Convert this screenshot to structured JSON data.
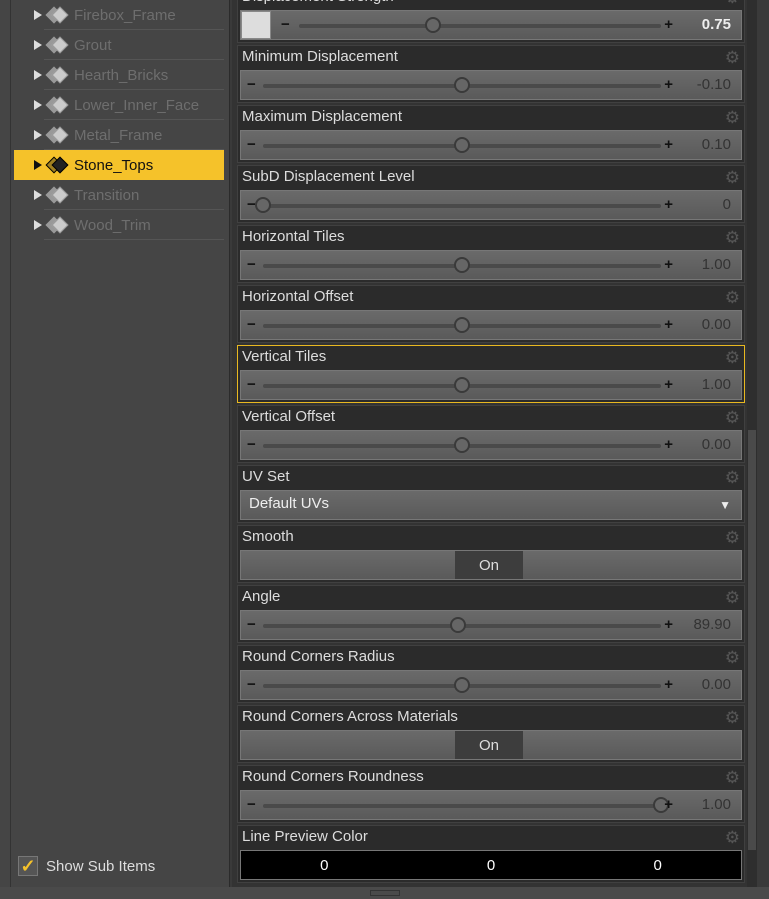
{
  "tree": {
    "items": [
      {
        "label": "Firebox_Frame",
        "selected": false
      },
      {
        "label": "Grout",
        "selected": false
      },
      {
        "label": "Hearth_Bricks",
        "selected": false
      },
      {
        "label": "Lower_Inner_Face",
        "selected": false
      },
      {
        "label": "Metal_Frame",
        "selected": false
      },
      {
        "label": "Stone_Tops",
        "selected": true
      },
      {
        "label": "Transition",
        "selected": false
      },
      {
        "label": "Wood_Trim",
        "selected": false
      }
    ],
    "show_sub_items": {
      "label": "Show Sub Items",
      "checked": true
    }
  },
  "properties": [
    {
      "label": "Displacement Strength",
      "type": "slider_swatch",
      "value": "0.75",
      "slider_position": 0.37
    },
    {
      "label": "Minimum Displacement",
      "type": "slider",
      "value": "-0.10",
      "slider_position": 0.5
    },
    {
      "label": "Maximum Displacement",
      "type": "slider",
      "value": "0.10",
      "slider_position": 0.5
    },
    {
      "label": "SubD Displacement Level",
      "type": "slider",
      "value": "0",
      "slider_position": 0
    },
    {
      "label": "Horizontal Tiles",
      "type": "slider",
      "value": "1.00",
      "slider_position": 0.5
    },
    {
      "label": "Horizontal Offset",
      "type": "slider",
      "value": "0.00",
      "slider_position": 0.5
    },
    {
      "label": "Vertical Tiles",
      "type": "slider",
      "value": "1.00",
      "slider_position": 0.5,
      "highlighted": true
    },
    {
      "label": "Vertical Offset",
      "type": "slider",
      "value": "0.00",
      "slider_position": 0.5
    },
    {
      "label": "UV Set",
      "type": "dropdown",
      "value": "Default UVs"
    },
    {
      "label": "Smooth",
      "type": "toggle",
      "value": "On"
    },
    {
      "label": "Angle",
      "type": "slider",
      "value": "89.90",
      "slider_position": 0.49
    },
    {
      "label": "Round Corners Radius",
      "type": "slider",
      "value": "0.00",
      "slider_position": 0.5
    },
    {
      "label": "Round Corners Across Materials",
      "type": "toggle",
      "value": "On"
    },
    {
      "label": "Round Corners Roundness",
      "type": "slider",
      "value": "1.00",
      "slider_position": 1.0
    },
    {
      "label": "Line Preview Color",
      "type": "color",
      "value": [
        "0",
        "0",
        "0"
      ]
    }
  ]
}
